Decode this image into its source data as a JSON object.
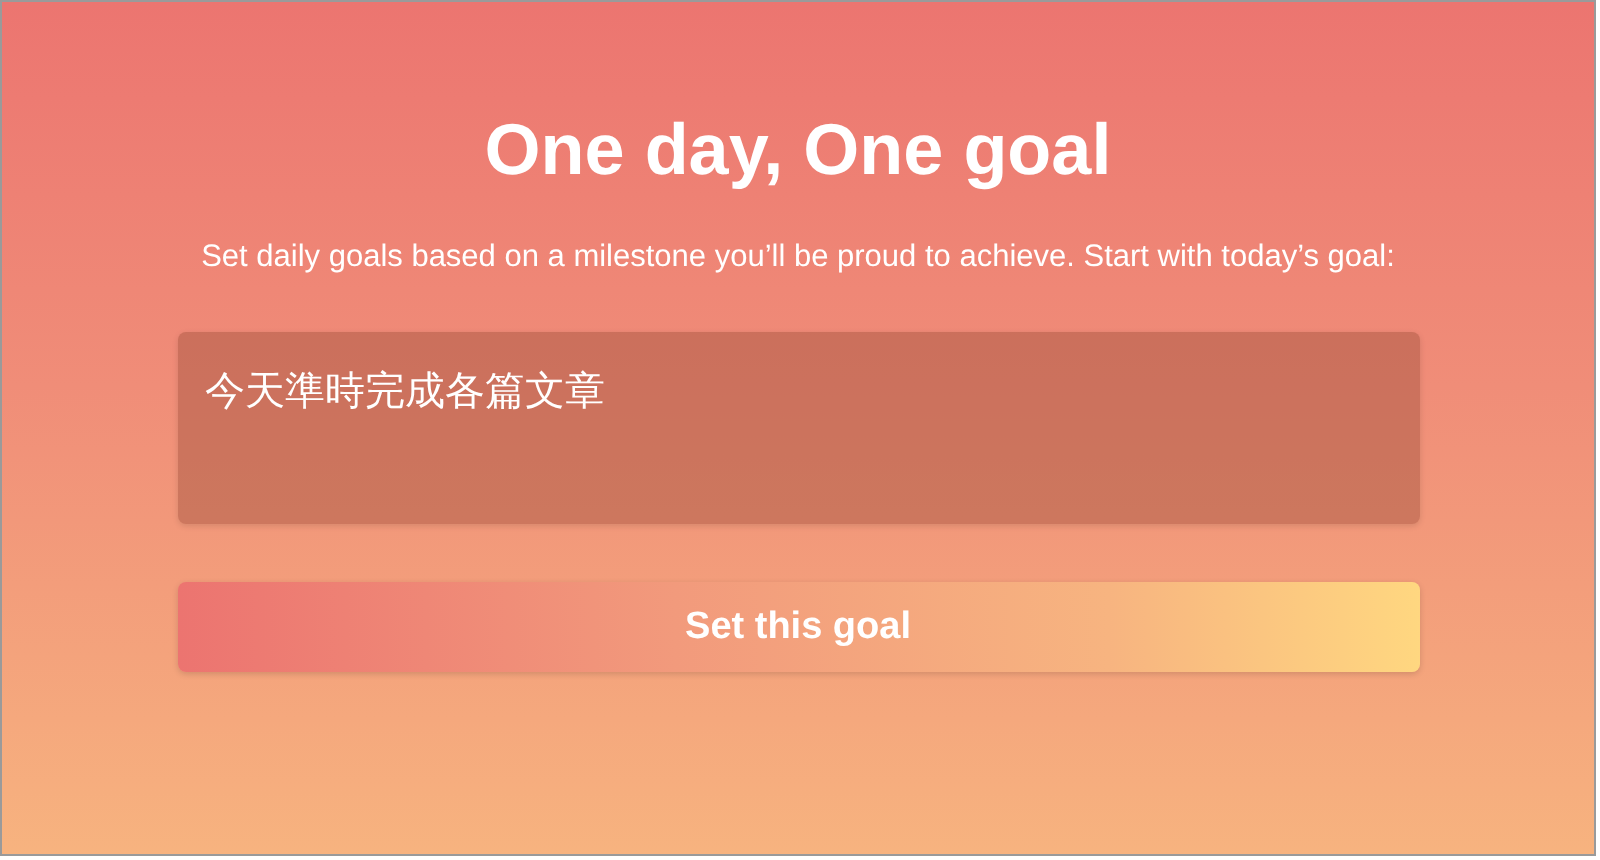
{
  "title": "One day, One goal",
  "subtitle": "Set daily goals based on a milestone you’ll be proud to achieve. Start with today’s goal:",
  "goal_field": {
    "value": "今天準時完成各篇文章"
  },
  "button": {
    "label": "Set this goal"
  }
}
